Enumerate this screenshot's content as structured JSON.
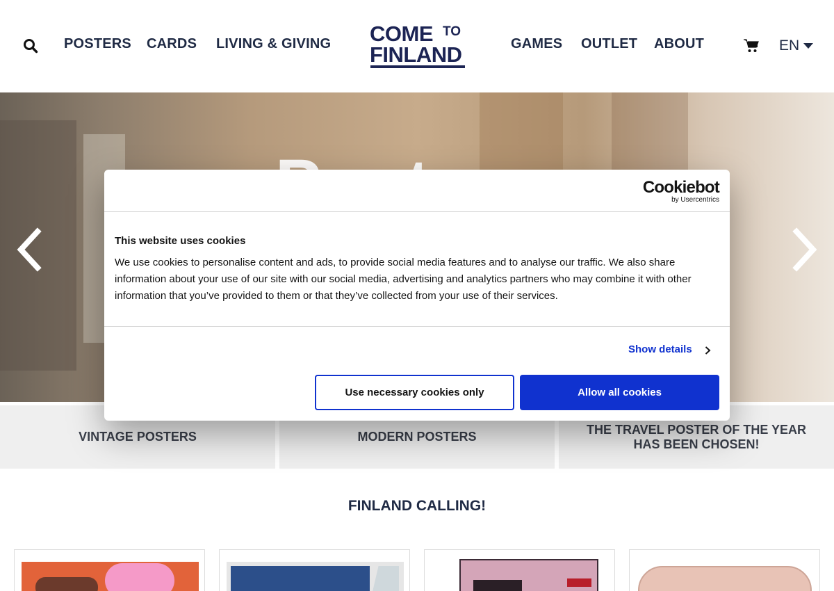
{
  "header": {
    "nav_left": [
      "POSTERS",
      "CARDS",
      "LIVING & GIVING"
    ],
    "nav_right": [
      "GAMES",
      "OUTLET",
      "ABOUT"
    ],
    "logo_line1": "COME",
    "logo_line1_small": "TO",
    "logo_line2": "FINLAND",
    "language": "EN"
  },
  "hero": {
    "title": "Posters"
  },
  "tiles": [
    "VINTAGE POSTERS",
    "MODERN POSTERS",
    "THE TRAVEL POSTER OF THE YEAR HAS BEEN CHOSEN!"
  ],
  "section_title": "FINLAND CALLING!",
  "cookie": {
    "brand": "Cookiebot",
    "brand_sub": "by Usercentrics",
    "heading": "This website uses cookies",
    "body": "We use cookies to personalise content and ads, to provide social media features and to analyse our traffic. We also share information about your use of our site with our social media, advertising and analytics partners who may combine it with other information that you’ve provided to them or that they’ve collected from your use of their services.",
    "show_details": "Show details",
    "necessary_label": "Use necessary cookies only",
    "allow_label": "Allow all cookies"
  },
  "colors": {
    "navy": "#1f2a44",
    "logo_navy": "#1c2454",
    "cookie_blue": "#1032cf",
    "tile_bg": "#efefef"
  },
  "icons": [
    "search-icon",
    "cart-icon",
    "chevron-left-icon",
    "chevron-right-icon",
    "caret-down-icon"
  ]
}
